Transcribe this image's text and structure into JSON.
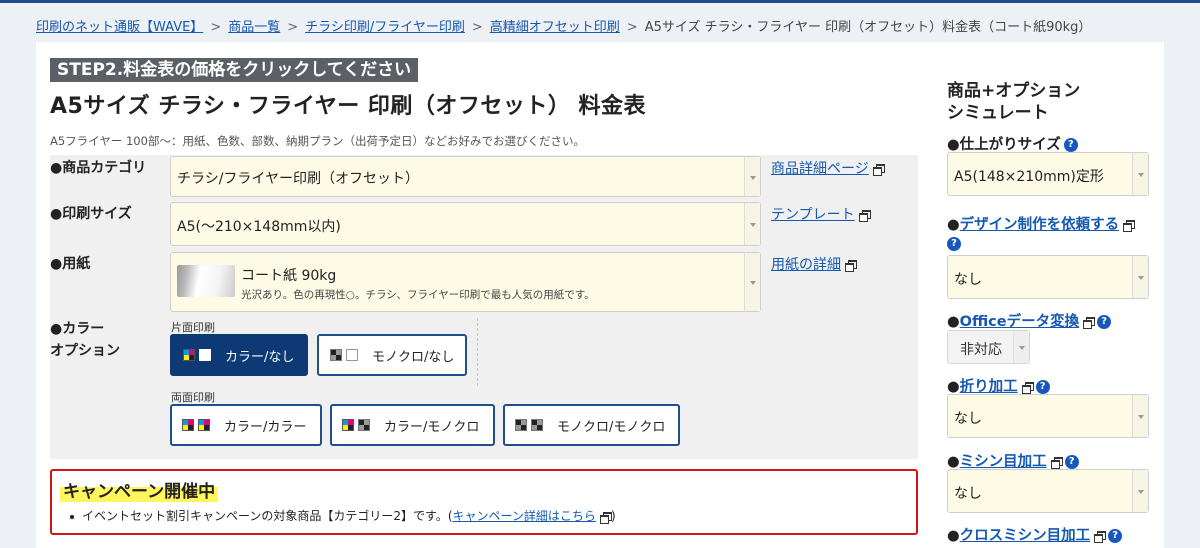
{
  "breadcrumb": {
    "items": [
      "印刷のネット通販【WAVE】",
      "商品一覧",
      "チラシ印刷/フライヤー印刷",
      "高精細オフセット印刷"
    ],
    "current": "A5サイズ チラシ・フライヤー 印刷（オフセット）料金表（コート紙90kg）",
    "separator": ">"
  },
  "header": {
    "step_badge": "STEP2.料金表の価格をクリックしてください",
    "title": "A5サイズ チラシ・フライヤー 印刷（オフセット） 料金表",
    "description": "A5フライヤー 100部～：用紙、色数、部数、納期プラン（出荷予定日）などお好みでお選びください。"
  },
  "form": {
    "category": {
      "label": "●商品カテゴリ",
      "value": "チラシ/フライヤー印刷（オフセット）",
      "link": "商品詳細ページ"
    },
    "size": {
      "label": "●印刷サイズ",
      "value": "A5(～210×148mm以内)",
      "link": "テンプレート"
    },
    "paper": {
      "label": "●用紙",
      "name": "コート紙 90kg",
      "description": "光沢あり。色の再現性○。チラシ、フライヤー印刷で最も人気の用紙です。",
      "link": "用紙の詳細"
    },
    "color": {
      "label_line1": "●カラー",
      "label_line2": "オプション",
      "single_label": "片面印刷",
      "double_label": "両面印刷",
      "single_options": [
        {
          "label": "カラー/なし",
          "selected": true
        },
        {
          "label": "モノクロ/なし",
          "selected": false
        }
      ],
      "double_options": [
        {
          "label": "カラー/カラー",
          "selected": false
        },
        {
          "label": "カラー/モノクロ",
          "selected": false
        },
        {
          "label": "モノクロ/モノクロ",
          "selected": false
        }
      ]
    }
  },
  "campaign": {
    "title": "キャンペーン開催中",
    "text_before": "イベントセット割引キャンペーンの対象商品【カテゴリー2】です。(",
    "link": "キャンペーン詳細はこちら",
    "text_after": ")"
  },
  "simulator": {
    "title_line1": "商品+オプション",
    "title_line2": "シミュレート",
    "finish_size": {
      "label": "●仕上がりサイズ",
      "value": "A5(148×210mm)定形"
    },
    "design": {
      "bullet": "●",
      "link": "デザイン制作を依頼する",
      "value": "なし"
    },
    "office": {
      "bullet": "●",
      "link": "Officeデータ変換",
      "value": "非対応"
    },
    "folding": {
      "bullet": "●",
      "link": "折り加工",
      "value": "なし"
    },
    "perforation": {
      "bullet": "●",
      "link": "ミシン目加工",
      "value": "なし"
    },
    "cross_perforation": {
      "bullet": "●",
      "link": "クロスミシン目加工"
    }
  },
  "icons": {
    "help": "?"
  },
  "colors": {
    "link": "#1558b0",
    "selected_option_bg": "#0d3a75",
    "select_bg": "#fdfbe6",
    "campaign_border": "#cf1616",
    "highlight": "#fff55c"
  }
}
